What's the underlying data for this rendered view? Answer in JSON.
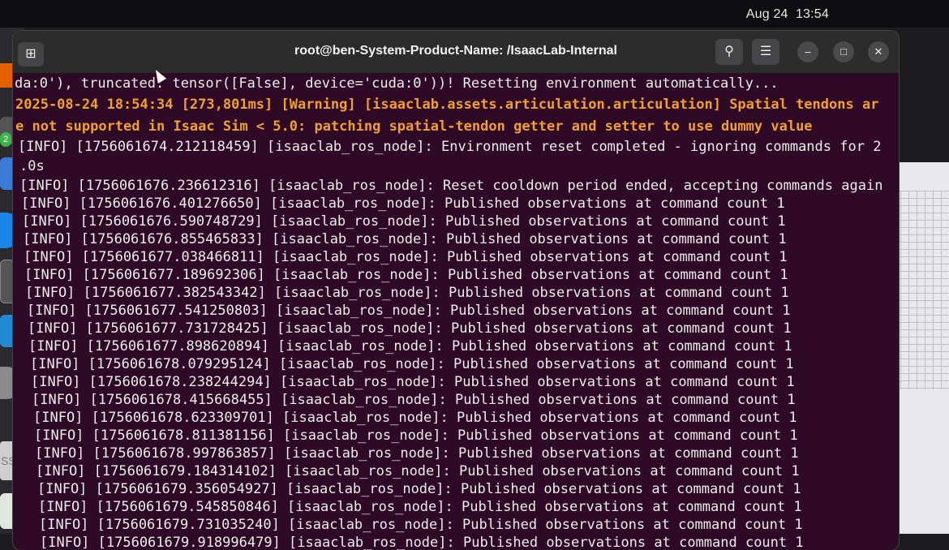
{
  "topbar": {
    "date": "Aug 24",
    "time": "13:54"
  },
  "dock": {
    "badge_count": "2",
    "ssd_label": "SSD"
  },
  "window": {
    "title": "root@ben-System-Product-Name: /IsaacLab-Internal"
  },
  "terminal": {
    "lines": [
      {
        "text": "da:0'), truncated: tensor([False], device='cuda:0'))! Resetting environment automatically...",
        "style": "normal"
      },
      {
        "text": "2025-08-24 18:54:34 [273,801ms] [Warning] [isaaclab.assets.articulation.articulation] Spatial tendons ar",
        "style": "warn"
      },
      {
        "text": "e not supported in Isaac Sim < 5.0: patching spatial-tendon getter and setter to use dummy value",
        "style": "warn"
      },
      {
        "text": "[INFO] [1756061674.212118459] [isaaclab_ros_node]: Environment reset completed - ignoring commands for 2",
        "style": "normal"
      },
      {
        "text": ".0s",
        "style": "normal"
      },
      {
        "text": "[INFO] [1756061676.236612316] [isaaclab_ros_node]: Reset cooldown period ended, accepting commands again",
        "style": "normal"
      },
      {
        "text": "[INFO] [1756061676.401276650] [isaaclab_ros_node]: Published observations at command count 1",
        "style": "normal"
      },
      {
        "text": "[INFO] [1756061676.590748729] [isaaclab_ros_node]: Published observations at command count 1",
        "style": "normal"
      },
      {
        "text": "[INFO] [1756061676.855465833] [isaaclab_ros_node]: Published observations at command count 1",
        "style": "normal"
      },
      {
        "text": "[INFO] [1756061677.038466811] [isaaclab_ros_node]: Published observations at command count 1",
        "style": "normal"
      },
      {
        "text": "[INFO] [1756061677.189692306] [isaaclab_ros_node]: Published observations at command count 1",
        "style": "normal"
      },
      {
        "text": "[INFO] [1756061677.382543342] [isaaclab_ros_node]: Published observations at command count 1",
        "style": "normal"
      },
      {
        "text": "[INFO] [1756061677.541250803] [isaaclab_ros_node]: Published observations at command count 1",
        "style": "normal"
      },
      {
        "text": "[INFO] [1756061677.731728425] [isaaclab_ros_node]: Published observations at command count 1",
        "style": "normal"
      },
      {
        "text": "[INFO] [1756061677.898620894] [isaaclab_ros_node]: Published observations at command count 1",
        "style": "normal"
      },
      {
        "text": "[INFO] [1756061678.079295124] [isaaclab_ros_node]: Published observations at command count 1",
        "style": "normal"
      },
      {
        "text": "[INFO] [1756061678.238244294] [isaaclab_ros_node]: Published observations at command count 1",
        "style": "normal"
      },
      {
        "text": "[INFO] [1756061678.415668455] [isaaclab_ros_node]: Published observations at command count 1",
        "style": "normal"
      },
      {
        "text": "[INFO] [1756061678.623309701] [isaaclab_ros_node]: Published observations at command count 1",
        "style": "normal"
      },
      {
        "text": "[INFO] [1756061678.811381156] [isaaclab_ros_node]: Published observations at command count 1",
        "style": "normal"
      },
      {
        "text": "[INFO] [1756061678.997863857] [isaaclab_ros_node]: Published observations at command count 1",
        "style": "normal"
      },
      {
        "text": "[INFO] [1756061679.184314102] [isaaclab_ros_node]: Published observations at command count 1",
        "style": "normal"
      },
      {
        "text": "[INFO] [1756061679.356054927] [isaaclab_ros_node]: Published observations at command count 1",
        "style": "normal"
      },
      {
        "text": "[INFO] [1756061679.545850846] [isaaclab_ros_node]: Published observations at command count 1",
        "style": "normal"
      },
      {
        "text": "[INFO] [1756061679.731035240] [isaaclab_ros_node]: Published observations at command count 1",
        "style": "normal"
      },
      {
        "text": "[INFO] [1756061679.918996479] [isaaclab_ros_node]: Published observations at command count 1",
        "style": "normal"
      }
    ]
  },
  "icons": {
    "new_tab": "new-tab-icon",
    "search": "search-icon",
    "menu": "hamburger-menu-icon",
    "minimize": "minimize-icon",
    "maximize": "maximize-icon",
    "close": "close-icon"
  },
  "colors": {
    "terminal_bg": "#2f0a26",
    "warning": "#f0a030",
    "text": "#ececec",
    "titlebar": "#2c2c2c"
  }
}
